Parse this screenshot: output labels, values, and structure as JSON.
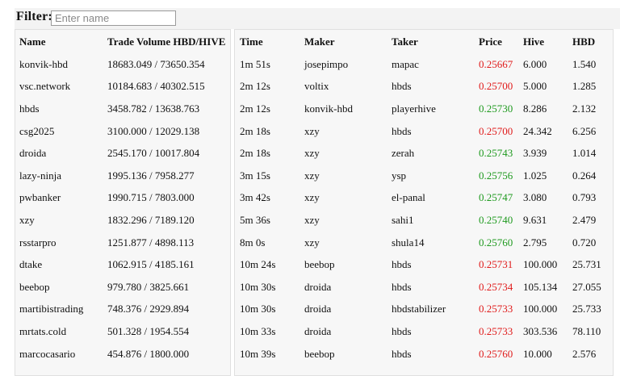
{
  "filter": {
    "label": "Filter:",
    "placeholder": "Enter name",
    "value": ""
  },
  "colors": {
    "sell_price": "#e01b1b",
    "buy_price": "#1f9a1f"
  },
  "volume_table": {
    "headers": {
      "name": "Name",
      "volume": "Trade Volume HBD/HIVE"
    },
    "rows": [
      {
        "name": "konvik-hbd",
        "volume": "18683.049 / 73650.354"
      },
      {
        "name": "vsc.network",
        "volume": "10184.683 / 40302.515"
      },
      {
        "name": "hbds",
        "volume": "3458.782 / 13638.763"
      },
      {
        "name": "csg2025",
        "volume": "3100.000 / 12029.138"
      },
      {
        "name": "droida",
        "volume": "2545.170 / 10017.804"
      },
      {
        "name": "lazy-ninja",
        "volume": "1995.136 / 7958.277"
      },
      {
        "name": "pwbanker",
        "volume": "1990.715 / 7803.000"
      },
      {
        "name": "xzy",
        "volume": "1832.296 / 7189.120"
      },
      {
        "name": "rsstarpro",
        "volume": "1251.877 / 4898.113"
      },
      {
        "name": "dtake",
        "volume": "1062.915 / 4185.161"
      },
      {
        "name": "beebop",
        "volume": "979.780 / 3825.661"
      },
      {
        "name": "martibistrading",
        "volume": "748.376 / 2929.894"
      },
      {
        "name": "mrtats.cold",
        "volume": "501.328 / 1954.554"
      },
      {
        "name": "marcocasario",
        "volume": "454.876 / 1800.000"
      }
    ]
  },
  "trades_table": {
    "headers": {
      "time": "Time",
      "maker": "Maker",
      "taker": "Taker",
      "price": "Price",
      "hive": "Hive",
      "hbd": "HBD"
    },
    "rows": [
      {
        "time": "1m 51s",
        "maker": "josepimpo",
        "taker": "mapac",
        "price": "0.25667",
        "side": "sell",
        "hive": "6.000",
        "hbd": "1.540"
      },
      {
        "time": "2m 12s",
        "maker": "voltix",
        "taker": "hbds",
        "price": "0.25700",
        "side": "sell",
        "hive": "5.000",
        "hbd": "1.285"
      },
      {
        "time": "2m 12s",
        "maker": "konvik-hbd",
        "taker": "playerhive",
        "price": "0.25730",
        "side": "buy",
        "hive": "8.286",
        "hbd": "2.132"
      },
      {
        "time": "2m 18s",
        "maker": "xzy",
        "taker": "hbds",
        "price": "0.25700",
        "side": "sell",
        "hive": "24.342",
        "hbd": "6.256"
      },
      {
        "time": "2m 18s",
        "maker": "xzy",
        "taker": "zerah",
        "price": "0.25743",
        "side": "buy",
        "hive": "3.939",
        "hbd": "1.014"
      },
      {
        "time": "3m 15s",
        "maker": "xzy",
        "taker": "ysp",
        "price": "0.25756",
        "side": "buy",
        "hive": "1.025",
        "hbd": "0.264"
      },
      {
        "time": "3m 42s",
        "maker": "xzy",
        "taker": "el-panal",
        "price": "0.25747",
        "side": "buy",
        "hive": "3.080",
        "hbd": "0.793"
      },
      {
        "time": "5m 36s",
        "maker": "xzy",
        "taker": "sahi1",
        "price": "0.25740",
        "side": "buy",
        "hive": "9.631",
        "hbd": "2.479"
      },
      {
        "time": "8m 0s",
        "maker": "xzy",
        "taker": "shula14",
        "price": "0.25760",
        "side": "buy",
        "hive": "2.795",
        "hbd": "0.720"
      },
      {
        "time": "10m 24s",
        "maker": "beebop",
        "taker": "hbds",
        "price": "0.25731",
        "side": "sell",
        "hive": "100.000",
        "hbd": "25.731"
      },
      {
        "time": "10m 30s",
        "maker": "droida",
        "taker": "hbds",
        "price": "0.25734",
        "side": "sell",
        "hive": "105.134",
        "hbd": "27.055"
      },
      {
        "time": "10m 30s",
        "maker": "droida",
        "taker": "hbdstabilizer",
        "price": "0.25733",
        "side": "sell",
        "hive": "100.000",
        "hbd": "25.733"
      },
      {
        "time": "10m 33s",
        "maker": "droida",
        "taker": "hbds",
        "price": "0.25733",
        "side": "sell",
        "hive": "303.536",
        "hbd": "78.110"
      },
      {
        "time": "10m 39s",
        "maker": "beebop",
        "taker": "hbds",
        "price": "0.25760",
        "side": "sell",
        "hive": "10.000",
        "hbd": "2.576"
      }
    ]
  }
}
